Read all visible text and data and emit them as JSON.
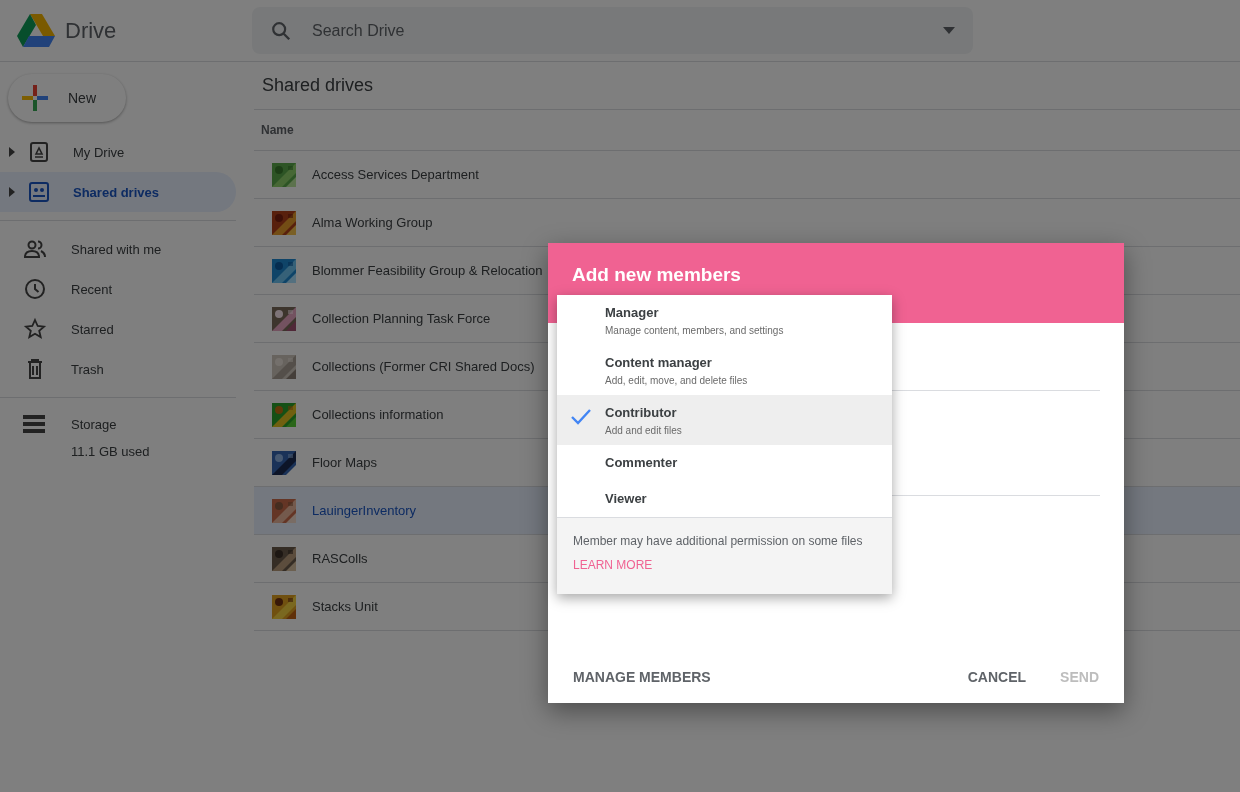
{
  "header": {
    "app_name": "Drive",
    "search": {
      "placeholder": "Search Drive"
    }
  },
  "sidebar": {
    "new_button": "New",
    "drives": [
      {
        "label": "My Drive",
        "expanded": false,
        "selected": false
      },
      {
        "label": "Shared drives",
        "expanded": false,
        "selected": true
      }
    ],
    "items": [
      {
        "label": "Shared with me",
        "selected": false
      },
      {
        "label": "Recent",
        "selected": false
      },
      {
        "label": "Starred",
        "selected": false
      },
      {
        "label": "Trash",
        "selected": false
      }
    ],
    "storage": {
      "label": "Storage",
      "usage": "11.1 GB used"
    }
  },
  "main": {
    "title": "Shared drives",
    "table": {
      "columns": [
        "Name"
      ],
      "rows": [
        {
          "name": "Access Services Department",
          "selected": false
        },
        {
          "name": "Alma Working Group",
          "selected": false
        },
        {
          "name": "Blommer Feasibility Group & Relocation",
          "selected": false
        },
        {
          "name": "Collection Planning Task Force",
          "selected": false
        },
        {
          "name": "Collections (Former CRI Shared Docs)",
          "selected": false
        },
        {
          "name": "Collections information",
          "selected": false
        },
        {
          "name": "Floor Maps",
          "selected": false
        },
        {
          "name": "LauingerInventory",
          "selected": true
        },
        {
          "name": "RASColls",
          "selected": false
        },
        {
          "name": "Stacks Unit",
          "selected": false
        }
      ]
    }
  },
  "dialog": {
    "title": "Add new members",
    "role_menu": {
      "options": [
        {
          "label": "Manager",
          "description": "Manage content, members, and settings",
          "selected": false
        },
        {
          "label": "Content manager",
          "description": "Add, edit, move, and delete files",
          "selected": false
        },
        {
          "label": "Contributor",
          "description": "Add and edit files",
          "selected": true
        },
        {
          "label": "Commenter",
          "selected": false
        },
        {
          "label": "Viewer",
          "selected": false
        }
      ],
      "note": "Member may have additional permission on some files",
      "link": "LEARN MORE"
    },
    "buttons": [
      {
        "label": "MANAGE MEMBERS",
        "disabled": false
      },
      {
        "label": "CANCEL",
        "disabled": false
      },
      {
        "label": "SEND",
        "disabled": true
      }
    ]
  }
}
